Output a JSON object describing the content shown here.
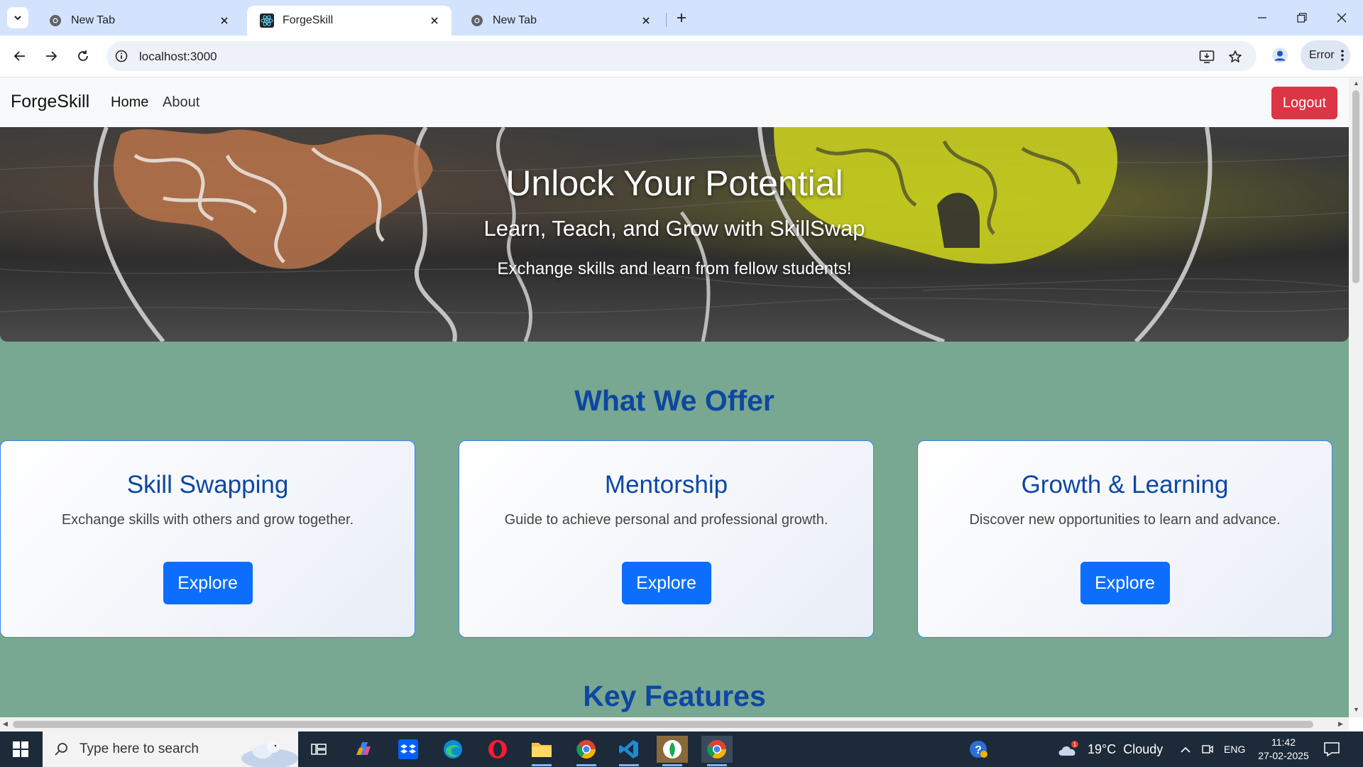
{
  "browser": {
    "tabs": [
      {
        "title": "New Tab",
        "active": false
      },
      {
        "title": "ForgeSkill",
        "active": true
      },
      {
        "title": "New Tab",
        "active": false
      }
    ],
    "url": "localhost:3000",
    "profile_chip": "Error"
  },
  "site": {
    "brand": "ForgeSkill",
    "nav": {
      "home": "Home",
      "about": "About",
      "logout": "Logout"
    },
    "hero": {
      "title": "Unlock Your Potential",
      "subtitle": "Learn, Teach, and Grow with SkillSwap",
      "tagline": "Exchange skills and learn from fellow students!"
    },
    "offer_heading": "What We Offer",
    "cards": [
      {
        "title": "Skill Swapping",
        "desc": "Exchange skills with others and grow together.",
        "button": "Explore"
      },
      {
        "title": "Mentorship",
        "desc": "Guide to achieve personal and professional growth.",
        "button": "Explore"
      },
      {
        "title": "Growth & Learning",
        "desc": "Discover new opportunities to learn and advance.",
        "button": "Explore"
      }
    ],
    "features_heading": "Key Features"
  },
  "taskbar": {
    "search_placeholder": "Type here to search",
    "weather": "19°C  Cloudy",
    "language": "ENG",
    "time": "11:42",
    "date": "27-02-2025"
  },
  "colors": {
    "page_bg": "#78a891",
    "heading_blue": "#0d47a1",
    "primary_button": "#0d6efd",
    "logout_red": "#dc3545"
  }
}
